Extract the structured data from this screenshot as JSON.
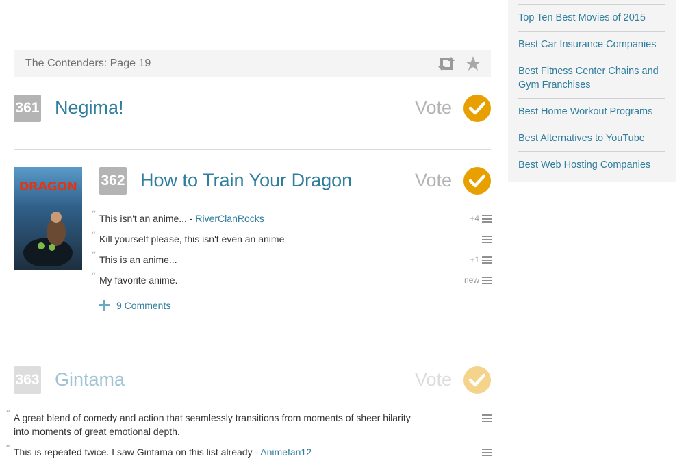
{
  "header": {
    "title": "The Contenders: Page 19",
    "retweet_icon": "retweet-icon",
    "star_icon": "star-icon"
  },
  "items": [
    {
      "rank": "361",
      "title": "Negima!",
      "vote_label": "Vote"
    },
    {
      "rank": "362",
      "title": "How to Train Your Dragon",
      "vote_label": "Vote",
      "thumbnail_text": "DRAGON",
      "comments": [
        {
          "text": "This isn't an anime... - ",
          "author": "RiverClanRocks",
          "score": "+4"
        },
        {
          "text": "Kill yourself please, this isn't even an anime",
          "author": "",
          "score": ""
        },
        {
          "text": "This is an anime...",
          "author": "",
          "score": "+1"
        },
        {
          "text": "My favorite anime.",
          "author": "",
          "score": "new"
        }
      ],
      "more_comments": "9 Comments"
    },
    {
      "rank": "363",
      "title": "Gintama",
      "vote_label": "Vote",
      "comments": [
        {
          "line1": "A great blend of comedy and action that seamlessly transitions from moments of sheer hilarity",
          "line2": "into moments of great emotional depth."
        },
        {
          "text": "This is repeated twice. I saw Gintama on this list already - ",
          "author": "Animefan12"
        }
      ]
    }
  ],
  "sidebar": {
    "links": [
      "Top Ten Best Movies of 2015",
      "Best Car Insurance Companies",
      "Best Fitness Center Chains and Gym Franchises",
      "Best Home Workout Programs",
      "Best Alternatives to YouTube",
      "Best Web Hosting Companies"
    ]
  },
  "colors": {
    "accent": "#2f7e9e",
    "vote": "#e8a000",
    "badge": "#b4b4b4"
  }
}
